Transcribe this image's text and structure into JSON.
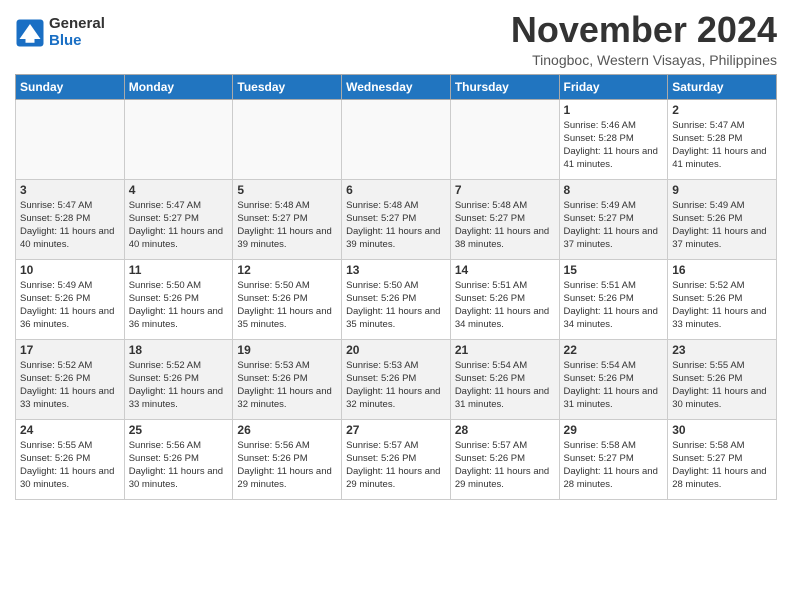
{
  "header": {
    "logo": {
      "general": "General",
      "blue": "Blue"
    },
    "title": "November 2024",
    "location": "Tinogboc, Western Visayas, Philippines"
  },
  "calendar": {
    "days_of_week": [
      "Sunday",
      "Monday",
      "Tuesday",
      "Wednesday",
      "Thursday",
      "Friday",
      "Saturday"
    ],
    "weeks": [
      [
        {
          "day": "",
          "info": ""
        },
        {
          "day": "",
          "info": ""
        },
        {
          "day": "",
          "info": ""
        },
        {
          "day": "",
          "info": ""
        },
        {
          "day": "",
          "info": ""
        },
        {
          "day": "1",
          "info": "Sunrise: 5:46 AM\nSunset: 5:28 PM\nDaylight: 11 hours and 41 minutes."
        },
        {
          "day": "2",
          "info": "Sunrise: 5:47 AM\nSunset: 5:28 PM\nDaylight: 11 hours and 41 minutes."
        }
      ],
      [
        {
          "day": "3",
          "info": "Sunrise: 5:47 AM\nSunset: 5:28 PM\nDaylight: 11 hours and 40 minutes."
        },
        {
          "day": "4",
          "info": "Sunrise: 5:47 AM\nSunset: 5:27 PM\nDaylight: 11 hours and 40 minutes."
        },
        {
          "day": "5",
          "info": "Sunrise: 5:48 AM\nSunset: 5:27 PM\nDaylight: 11 hours and 39 minutes."
        },
        {
          "day": "6",
          "info": "Sunrise: 5:48 AM\nSunset: 5:27 PM\nDaylight: 11 hours and 39 minutes."
        },
        {
          "day": "7",
          "info": "Sunrise: 5:48 AM\nSunset: 5:27 PM\nDaylight: 11 hours and 38 minutes."
        },
        {
          "day": "8",
          "info": "Sunrise: 5:49 AM\nSunset: 5:27 PM\nDaylight: 11 hours and 37 minutes."
        },
        {
          "day": "9",
          "info": "Sunrise: 5:49 AM\nSunset: 5:26 PM\nDaylight: 11 hours and 37 minutes."
        }
      ],
      [
        {
          "day": "10",
          "info": "Sunrise: 5:49 AM\nSunset: 5:26 PM\nDaylight: 11 hours and 36 minutes."
        },
        {
          "day": "11",
          "info": "Sunrise: 5:50 AM\nSunset: 5:26 PM\nDaylight: 11 hours and 36 minutes."
        },
        {
          "day": "12",
          "info": "Sunrise: 5:50 AM\nSunset: 5:26 PM\nDaylight: 11 hours and 35 minutes."
        },
        {
          "day": "13",
          "info": "Sunrise: 5:50 AM\nSunset: 5:26 PM\nDaylight: 11 hours and 35 minutes."
        },
        {
          "day": "14",
          "info": "Sunrise: 5:51 AM\nSunset: 5:26 PM\nDaylight: 11 hours and 34 minutes."
        },
        {
          "day": "15",
          "info": "Sunrise: 5:51 AM\nSunset: 5:26 PM\nDaylight: 11 hours and 34 minutes."
        },
        {
          "day": "16",
          "info": "Sunrise: 5:52 AM\nSunset: 5:26 PM\nDaylight: 11 hours and 33 minutes."
        }
      ],
      [
        {
          "day": "17",
          "info": "Sunrise: 5:52 AM\nSunset: 5:26 PM\nDaylight: 11 hours and 33 minutes."
        },
        {
          "day": "18",
          "info": "Sunrise: 5:52 AM\nSunset: 5:26 PM\nDaylight: 11 hours and 33 minutes."
        },
        {
          "day": "19",
          "info": "Sunrise: 5:53 AM\nSunset: 5:26 PM\nDaylight: 11 hours and 32 minutes."
        },
        {
          "day": "20",
          "info": "Sunrise: 5:53 AM\nSunset: 5:26 PM\nDaylight: 11 hours and 32 minutes."
        },
        {
          "day": "21",
          "info": "Sunrise: 5:54 AM\nSunset: 5:26 PM\nDaylight: 11 hours and 31 minutes."
        },
        {
          "day": "22",
          "info": "Sunrise: 5:54 AM\nSunset: 5:26 PM\nDaylight: 11 hours and 31 minutes."
        },
        {
          "day": "23",
          "info": "Sunrise: 5:55 AM\nSunset: 5:26 PM\nDaylight: 11 hours and 30 minutes."
        }
      ],
      [
        {
          "day": "24",
          "info": "Sunrise: 5:55 AM\nSunset: 5:26 PM\nDaylight: 11 hours and 30 minutes."
        },
        {
          "day": "25",
          "info": "Sunrise: 5:56 AM\nSunset: 5:26 PM\nDaylight: 11 hours and 30 minutes."
        },
        {
          "day": "26",
          "info": "Sunrise: 5:56 AM\nSunset: 5:26 PM\nDaylight: 11 hours and 29 minutes."
        },
        {
          "day": "27",
          "info": "Sunrise: 5:57 AM\nSunset: 5:26 PM\nDaylight: 11 hours and 29 minutes."
        },
        {
          "day": "28",
          "info": "Sunrise: 5:57 AM\nSunset: 5:26 PM\nDaylight: 11 hours and 29 minutes."
        },
        {
          "day": "29",
          "info": "Sunrise: 5:58 AM\nSunset: 5:27 PM\nDaylight: 11 hours and 28 minutes."
        },
        {
          "day": "30",
          "info": "Sunrise: 5:58 AM\nSunset: 5:27 PM\nDaylight: 11 hours and 28 minutes."
        }
      ]
    ]
  }
}
